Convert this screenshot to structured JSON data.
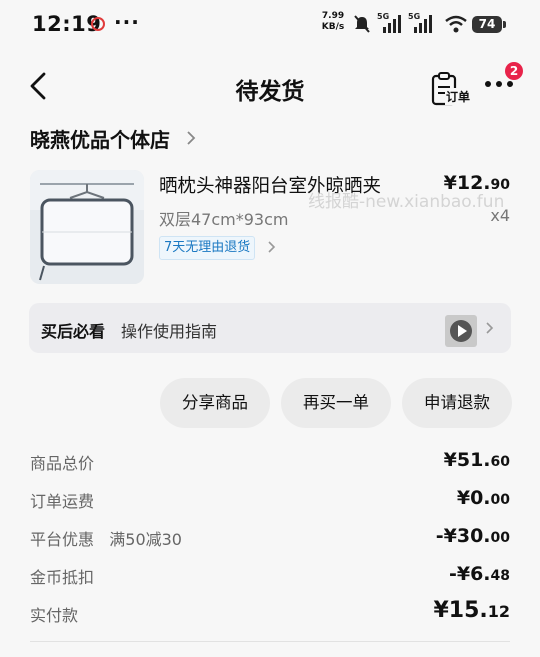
{
  "status_bar": {
    "time": "12:19",
    "dots": "···",
    "net_speed_value": "7.99",
    "net_speed_unit": "KB/s",
    "sim1": "5G",
    "sim2": "5G",
    "battery": "74"
  },
  "nav": {
    "title": "待发货",
    "order_label": "订单",
    "badge": "2"
  },
  "shop": {
    "name": "晓燕优品个体店"
  },
  "product": {
    "title": "晒枕头神器阳台室外晾晒夹",
    "spec": "双层47cm*93cm",
    "tag": "7天无理由退货",
    "price_main": "¥12.",
    "price_cents": "90",
    "quantity": "x4"
  },
  "watermark": "线报酷-new.xianbao.fun",
  "guide": {
    "label": "买后必看",
    "text": "操作使用指南"
  },
  "actions": {
    "share": "分享商品",
    "rebuy": "再买一单",
    "refund": "申请退款"
  },
  "summary": {
    "goods_total_label": "商品总价",
    "goods_total_main": "¥51.",
    "goods_total_cents": "60",
    "shipping_label": "订单运费",
    "shipping_main": "¥0.",
    "shipping_cents": "00",
    "discount_label": "平台优惠   满50减30",
    "discount_main": "-¥30.",
    "discount_cents": "00",
    "coins_label": "金币抵扣",
    "coins_main": "-¥6.",
    "coins_cents": "48",
    "paid_label": "实付款",
    "paid_main": "¥15.",
    "paid_cents": "12"
  },
  "colors": {
    "accent_badge": "#e8234a",
    "tag_blue": "#1a78c2"
  }
}
